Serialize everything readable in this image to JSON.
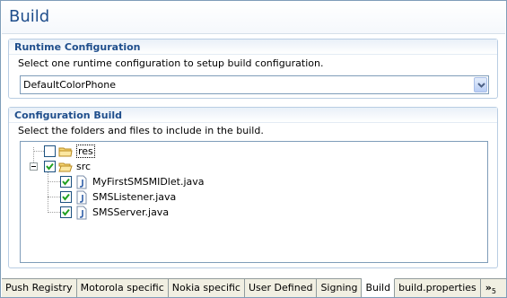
{
  "editor": {
    "title": "Build"
  },
  "runtime": {
    "header": "Runtime Configuration",
    "description": "Select one runtime configuration to setup build configuration.",
    "selected": "DefaultColorPhone"
  },
  "build": {
    "header": "Configuration Build",
    "description": "Select the folders and files to include in the build.",
    "tree": {
      "res": {
        "label": "res",
        "checked": false
      },
      "src": {
        "label": "src",
        "checked": true
      },
      "files": [
        {
          "label": "MyFirstSMSMIDlet.java",
          "checked": true
        },
        {
          "label": "SMSListener.java",
          "checked": true
        },
        {
          "label": "SMSServer.java",
          "checked": true
        }
      ]
    }
  },
  "tabs": [
    {
      "label": "Push Registry"
    },
    {
      "label": "Motorola specific"
    },
    {
      "label": "Nokia specific"
    },
    {
      "label": "User Defined"
    },
    {
      "label": "Signing"
    },
    {
      "label": "Build",
      "active": true
    },
    {
      "label": "build.properties"
    }
  ],
  "tabs_overflow": {
    "symbol": "»",
    "count": "5"
  }
}
